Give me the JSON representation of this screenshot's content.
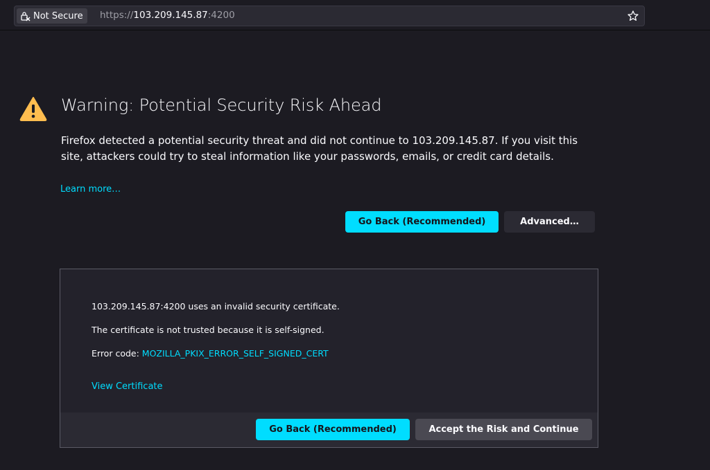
{
  "browser": {
    "identity_label": "Not Secure",
    "url_scheme": "https://",
    "url_host": "103.209.145.87",
    "url_port": ":4200"
  },
  "page": {
    "title": "Warning: Potential Security Risk Ahead",
    "intro": "Firefox detected a potential security threat and did not continue to 103.209.145.87. If you visit this site, attackers could try to steal information like your passwords, emails, or credit card details.",
    "learn_more": "Learn more…",
    "go_back_label": "Go Back (Recommended)",
    "advanced_label": "Advanced…"
  },
  "advanced": {
    "line1": "103.209.145.87:4200 uses an invalid security certificate.",
    "line2": "The certificate is not trusted because it is self-signed.",
    "error_code_prefix": "Error code: ",
    "error_code": "MOZILLA_PKIX_ERROR_SELF_SIGNED_CERT",
    "view_certificate": "View Certificate",
    "go_back_label": "Go Back (Recommended)",
    "accept_label": "Accept the Risk and Continue"
  },
  "colors": {
    "background": "#1c1b22",
    "accent": "#00ddff",
    "warning": "#ffbd4f"
  }
}
